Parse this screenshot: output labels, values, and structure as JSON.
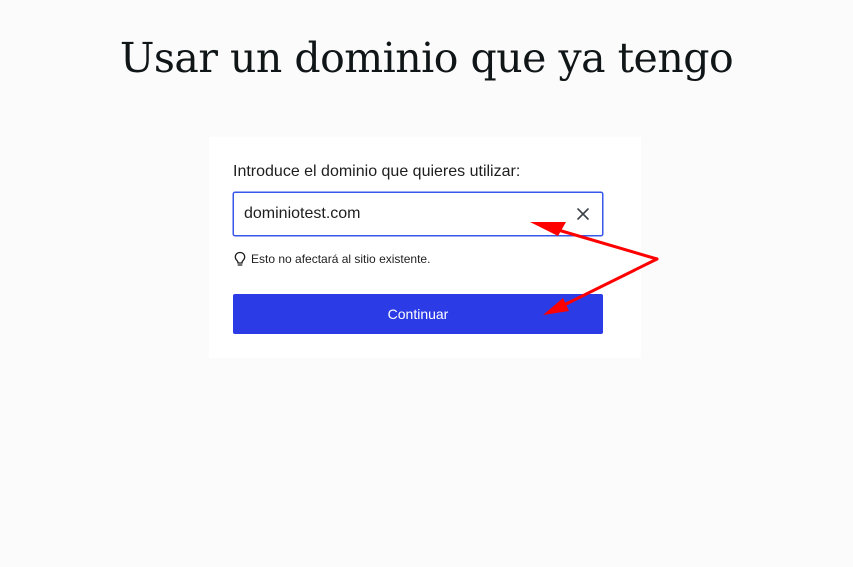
{
  "page": {
    "title": "Usar un dominio que ya tengo"
  },
  "form": {
    "label": "Introduce el dominio que quieres utilizar:",
    "domain_value": "dominiotest.com",
    "hint_text": "Esto no afectará al sitio existente.",
    "continue_label": "Continuar"
  },
  "icons": {
    "clear": "close-icon",
    "hint": "lightbulb-icon"
  },
  "colors": {
    "accent": "#2b3be6",
    "focus_border": "#3858e9",
    "annotation": "#ff0000"
  }
}
